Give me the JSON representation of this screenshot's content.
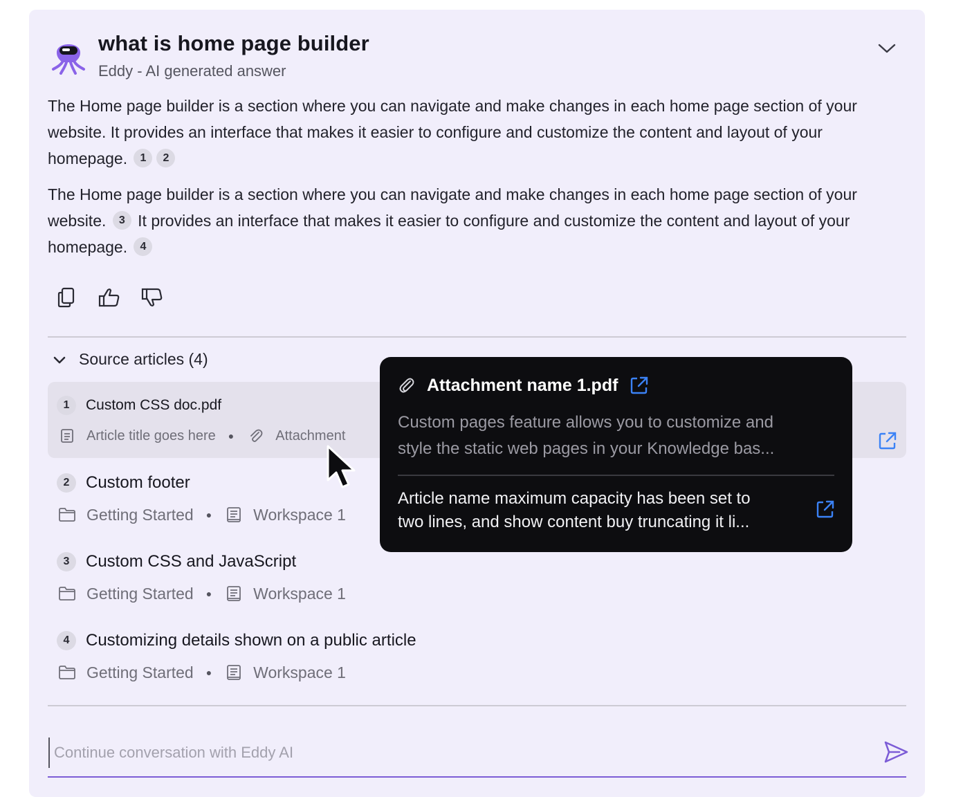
{
  "header": {
    "title": "what is home page builder",
    "subtitle": "Eddy - AI generated answer",
    "avatar_icon": "octopus-mascot-icon",
    "collapse_icon": "chevron-down-icon"
  },
  "answer": {
    "paragraphs": [
      {
        "text": "The Home page builder is a section where you can navigate and make changes in each home page section of your website. It provides an interface that makes it easier to configure and customize the content and layout of your homepage.",
        "citations": [
          "1",
          "2"
        ]
      },
      {
        "text_a": "The Home page builder is a section where you can navigate and make changes in each home page section of your website.",
        "citation_a": "3",
        "text_b": "It provides an interface that makes it easier to configure and customize the content and layout of your homepage.",
        "citation_b": "4"
      }
    ]
  },
  "actions": [
    {
      "name": "copy",
      "icon": "copy-icon"
    },
    {
      "name": "thumbs-up",
      "icon": "thumbs-up-icon"
    },
    {
      "name": "thumbs-down",
      "icon": "thumbs-down-icon"
    }
  ],
  "sources": {
    "title": "Source articles (4)",
    "items": [
      {
        "num": "1",
        "name": "Custom CSS doc.pdf",
        "meta1": "Article title goes here",
        "meta2": "Attachment",
        "meta1_icon": "document-icon",
        "meta2_icon": "paperclip-icon"
      },
      {
        "num": "2",
        "name": "Custom footer",
        "meta1": "Getting Started",
        "meta2": "Workspace 1",
        "meta1_icon": "folder-icon",
        "meta2_icon": "book-icon"
      },
      {
        "num": "3",
        "name": "Custom CSS and JavaScript",
        "meta1": "Getting Started",
        "meta2": "Workspace 1",
        "meta1_icon": "folder-icon",
        "meta2_icon": "book-icon"
      },
      {
        "num": "4",
        "name": "Customizing details shown on a public article",
        "meta1": "Getting Started",
        "meta2": "Workspace 1",
        "meta1_icon": "folder-icon",
        "meta2_icon": "book-icon"
      }
    ]
  },
  "tooltip": {
    "title": "Attachment name 1.pdf",
    "description_line1": "Custom pages feature allows you to customize and",
    "description_line2": "style the static web pages in your Knowledge bas...",
    "article_line1": "Article name maximum capacity has been set to",
    "article_line2": "two lines, and show content buy truncating it li..."
  },
  "input": {
    "placeholder": "Continue conversation with Eddy AI",
    "send_icon": "send-icon"
  },
  "colors": {
    "panel_bg": "#f1eefb",
    "accent_purple": "#7c5cd6",
    "link_blue": "#3b82f6",
    "tooltip_bg": "#0d0d10"
  }
}
